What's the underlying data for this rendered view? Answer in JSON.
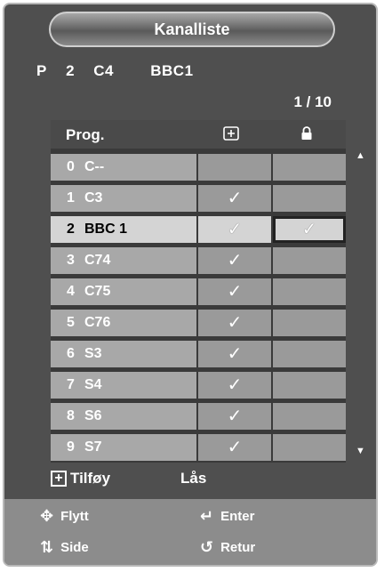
{
  "window": {
    "title": "Kanalliste"
  },
  "info": {
    "p_label": "P",
    "p_num": "2",
    "channel_code": "C4",
    "channel_name": "BBC1"
  },
  "page_indicator": "1 / 10",
  "table": {
    "header": {
      "prog": "Prog.",
      "add_icon": "plus-box-icon",
      "lock_icon": "lock-icon"
    },
    "rows": [
      {
        "num": "0",
        "name": "C--",
        "added": false,
        "locked": false,
        "selected": false
      },
      {
        "num": "1",
        "name": "C3",
        "added": true,
        "locked": false,
        "selected": false
      },
      {
        "num": "2",
        "name": "BBC 1",
        "added": true,
        "locked": true,
        "selected": true
      },
      {
        "num": "3",
        "name": "C74",
        "added": true,
        "locked": false,
        "selected": false
      },
      {
        "num": "4",
        "name": "C75",
        "added": true,
        "locked": false,
        "selected": false
      },
      {
        "num": "5",
        "name": "C76",
        "added": true,
        "locked": false,
        "selected": false
      },
      {
        "num": "6",
        "name": "S3",
        "added": true,
        "locked": false,
        "selected": false
      },
      {
        "num": "7",
        "name": "S4",
        "added": true,
        "locked": false,
        "selected": false
      },
      {
        "num": "8",
        "name": "S6",
        "added": true,
        "locked": false,
        "selected": false
      },
      {
        "num": "9",
        "name": "S7",
        "added": true,
        "locked": false,
        "selected": false
      }
    ]
  },
  "legend": {
    "add_label": "Tilføy",
    "lock_label": "Lås"
  },
  "help": {
    "move": "Flytt",
    "enter": "Enter",
    "page": "Side",
    "return": "Retur"
  },
  "glyphs": {
    "check": "✓",
    "plus": "+",
    "up": "▲",
    "down": "▼",
    "move": "✥",
    "enter": "↵",
    "page": "⇅",
    "return": "↺",
    "lock": "🔒"
  },
  "colors": {
    "panel": "#4f4f4f",
    "row": "#a8a8a8",
    "selected_row": "#d4d4d4",
    "bottom_bar": "#8c8c8c"
  }
}
